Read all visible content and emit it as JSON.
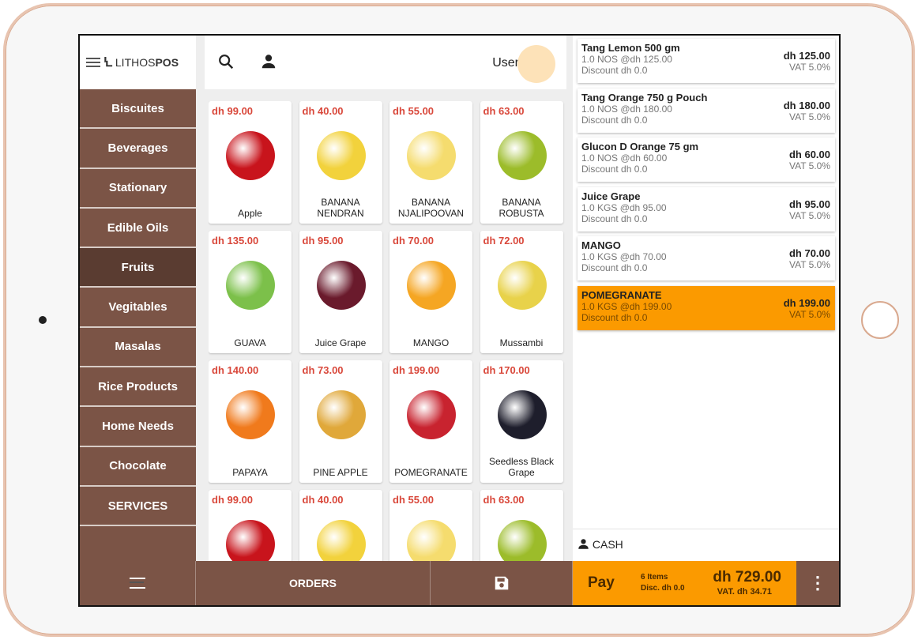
{
  "app": {
    "logo_text_light": "LITHOS",
    "logo_text_bold": "POS"
  },
  "header": {
    "user_label": "User",
    "search_icon": "search-icon",
    "person_icon": "person-icon"
  },
  "categories": [
    {
      "label": "Biscuites"
    },
    {
      "label": "Beverages"
    },
    {
      "label": "Stationary"
    },
    {
      "label": "Edible Oils"
    },
    {
      "label": "Fruits",
      "active": true
    },
    {
      "label": "Vegitables"
    },
    {
      "label": "Masalas"
    },
    {
      "label": "Rice Products"
    },
    {
      "label": "Home Needs"
    },
    {
      "label": "Chocolate"
    },
    {
      "label": "SERVICES"
    }
  ],
  "products": [
    {
      "price": "dh 99.00",
      "name": "Apple",
      "color": "#c8141c"
    },
    {
      "price": "dh 40.00",
      "name": "BANANA NENDRAN",
      "color": "#f2d23c"
    },
    {
      "price": "dh 55.00",
      "name": "BANANA NJALIPOOVAN",
      "color": "#f5dc6e"
    },
    {
      "price": "dh 63.00",
      "name": "BANANA ROBUSTA",
      "color": "#9cbc2a"
    },
    {
      "price": "dh 135.00",
      "name": "GUAVA",
      "color": "#7cc04a"
    },
    {
      "price": "dh 95.00",
      "name": "Juice Grape",
      "color": "#6a1a2c"
    },
    {
      "price": "dh 70.00",
      "name": "MANGO",
      "color": "#f5a623"
    },
    {
      "price": "dh 72.00",
      "name": "Mussambi",
      "color": "#e8d24a"
    },
    {
      "price": "dh 140.00",
      "name": "PAPAYA",
      "color": "#f07a1c"
    },
    {
      "price": "dh 73.00",
      "name": "PINE APPLE",
      "color": "#e0a83a"
    },
    {
      "price": "dh 199.00",
      "name": "POMEGRANATE",
      "color": "#c8232f"
    },
    {
      "price": "dh 170.00",
      "name": "Seedless Black Grape",
      "color": "#1e1e2c"
    },
    {
      "price": "dh 99.00",
      "name": "",
      "color": "#c8141c"
    },
    {
      "price": "dh 40.00",
      "name": "",
      "color": "#f2d23c"
    },
    {
      "price": "dh 55.00",
      "name": "",
      "color": "#f5dc6e"
    },
    {
      "price": "dh 63.00",
      "name": "",
      "color": "#9cbc2a"
    }
  ],
  "order_items": [
    {
      "name": "Tang Lemon 500 gm",
      "qty": "1.0 NOS @dh 125.00",
      "discount": "Discount dh 0.0",
      "amount": "dh 125.00",
      "vat": "VAT 5.0%"
    },
    {
      "name": "Tang Orange 750 g Pouch",
      "qty": "1.0 NOS @dh 180.00",
      "discount": "Discount dh 0.0",
      "amount": "dh 180.00",
      "vat": "VAT 5.0%"
    },
    {
      "name": "Glucon D Orange 75 gm",
      "qty": "1.0 NOS @dh 60.00",
      "discount": "Discount dh 0.0",
      "amount": "dh 60.00",
      "vat": "VAT 5.0%"
    },
    {
      "name": "Juice Grape",
      "qty": "1.0 KGS @dh 95.00",
      "discount": "Discount dh 0.0",
      "amount": "dh 95.00",
      "vat": "VAT 5.0%"
    },
    {
      "name": "MANGO",
      "qty": "1.0 KGS @dh 70.00",
      "discount": "Discount dh 0.0",
      "amount": "dh 70.00",
      "vat": "VAT 5.0%"
    },
    {
      "name": "POMEGRANATE",
      "qty": "1.0 KGS @dh 199.00",
      "discount": "Discount dh 0.0",
      "amount": "dh 199.00",
      "vat": "VAT 5.0%",
      "selected": true
    }
  ],
  "customer": {
    "label": "CASH"
  },
  "footer": {
    "orders_label": "ORDERS",
    "pay_label": "Pay",
    "items": "6 Items",
    "disc": "Disc. dh 0.0",
    "total": "dh 729.00",
    "vat": "VAT. dh 34.71"
  },
  "colors": {
    "brown": "#7b5446",
    "accent": "#fb9a00",
    "price": "#d9483b"
  }
}
